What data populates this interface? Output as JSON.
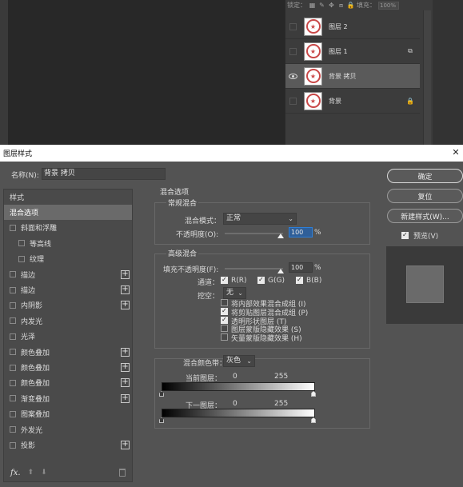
{
  "layers_panel": {
    "lock_label": "锁定：",
    "fill_label": "填充：",
    "fill_value": "100%",
    "layers": [
      {
        "name": "图层 2",
        "visible": false,
        "badge": "",
        "selected": false
      },
      {
        "name": "图层 1",
        "visible": false,
        "badge": "⧉",
        "selected": false
      },
      {
        "name": "背景 拷贝",
        "visible": true,
        "badge": "",
        "selected": true
      },
      {
        "name": "背景",
        "visible": false,
        "badge": "🔒",
        "selected": false
      }
    ]
  },
  "dialog": {
    "title": "图层样式",
    "close_icon": "close-icon",
    "name_label": "名称(N):",
    "name_value": "背景 拷贝",
    "style_list": {
      "header": "样式",
      "items": [
        {
          "label": "混合选项",
          "active": true,
          "checkbox": false,
          "indent": false,
          "plus": false
        },
        {
          "label": "斜面和浮雕",
          "active": false,
          "checkbox": true,
          "indent": false,
          "plus": false
        },
        {
          "label": "等高线",
          "active": false,
          "checkbox": true,
          "indent": true,
          "plus": false
        },
        {
          "label": "纹理",
          "active": false,
          "checkbox": true,
          "indent": true,
          "plus": false
        },
        {
          "label": "描边",
          "active": false,
          "checkbox": true,
          "indent": false,
          "plus": true
        },
        {
          "label": "描边",
          "active": false,
          "checkbox": true,
          "indent": false,
          "plus": true
        },
        {
          "label": "内阴影",
          "active": false,
          "checkbox": true,
          "indent": false,
          "plus": true
        },
        {
          "label": "内发光",
          "active": false,
          "checkbox": true,
          "indent": false,
          "plus": false
        },
        {
          "label": "光泽",
          "active": false,
          "checkbox": true,
          "indent": false,
          "plus": false
        },
        {
          "label": "颜色叠加",
          "active": false,
          "checkbox": true,
          "indent": false,
          "plus": true
        },
        {
          "label": "颜色叠加",
          "active": false,
          "checkbox": true,
          "indent": false,
          "plus": true
        },
        {
          "label": "颜色叠加",
          "active": false,
          "checkbox": true,
          "indent": false,
          "plus": true
        },
        {
          "label": "渐变叠加",
          "active": false,
          "checkbox": true,
          "indent": false,
          "plus": true
        },
        {
          "label": "图案叠加",
          "active": false,
          "checkbox": true,
          "indent": false,
          "plus": false
        },
        {
          "label": "外发光",
          "active": false,
          "checkbox": true,
          "indent": false,
          "plus": false
        },
        {
          "label": "投影",
          "active": false,
          "checkbox": true,
          "indent": false,
          "plus": true
        }
      ],
      "fx_label": "fx."
    },
    "blend_options": {
      "title": "混合选项",
      "general": {
        "title": "常规混合",
        "mode_label": "混合模式：",
        "mode_value": "正常",
        "opacity_label": "不透明度(O):",
        "opacity_value": "100",
        "opacity_level": 1.0,
        "unit": "%"
      },
      "advanced": {
        "title": "高级混合",
        "fill_label": "填充不透明度(F):",
        "fill_value": "100",
        "fill_level": 1.0,
        "unit": "%",
        "channels_label": "通道：",
        "channels": [
          {
            "label": "R(R)",
            "checked": true
          },
          {
            "label": "G(G)",
            "checked": true
          },
          {
            "label": "B(B)",
            "checked": true
          }
        ],
        "knockout_label": "挖空：",
        "knockout_value": "无",
        "options": [
          {
            "label": "将内部效果混合成组 (I)",
            "checked": false
          },
          {
            "label": "将剪贴图层混合成组 (P)",
            "checked": true
          },
          {
            "label": "透明形状图层 (T)",
            "checked": true
          },
          {
            "label": "图层蒙版隐藏效果 (S)",
            "checked": false
          },
          {
            "label": "矢量蒙版隐藏效果 (H)",
            "checked": false
          }
        ]
      },
      "blend_if": {
        "label": "混合颜色带：",
        "value": "灰色",
        "this_layer_label": "当前图层：",
        "this_layer_min": "0",
        "this_layer_max": "255",
        "underlying_label": "下一图层：",
        "underlying_min": "0",
        "underlying_max": "255"
      }
    },
    "buttons": {
      "ok": "确定",
      "reset": "复位",
      "new_style": "新建样式(W)...",
      "preview_label": "预览(V)",
      "preview_checked": true
    }
  }
}
